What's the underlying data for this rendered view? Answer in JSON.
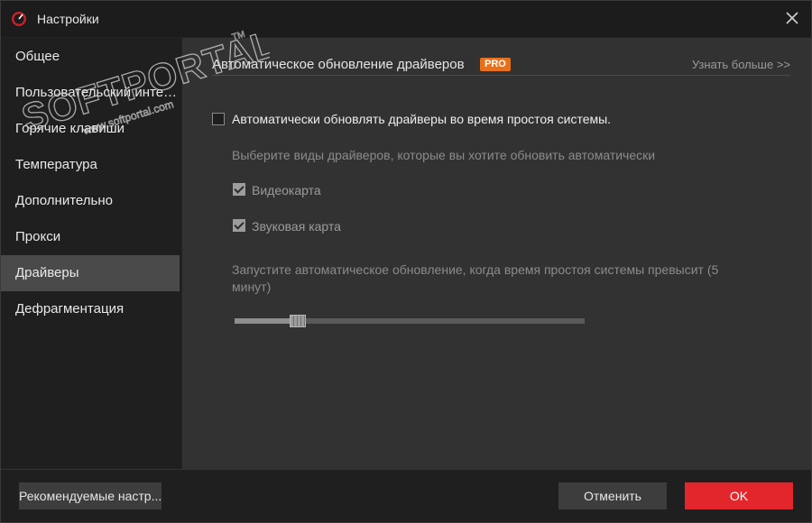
{
  "window": {
    "title": "Настройки",
    "icons": {
      "app": "app-speedometer-icon",
      "close": "close-icon"
    }
  },
  "sidebar": {
    "active_index": 6,
    "items": [
      {
        "label": "Общее"
      },
      {
        "label": "Пользовательский интерфейс"
      },
      {
        "label": "Горячие клавиши"
      },
      {
        "label": "Температура"
      },
      {
        "label": "Дополнительно"
      },
      {
        "label": "Прокси"
      },
      {
        "label": "Драйверы"
      },
      {
        "label": "Дефрагментация"
      }
    ]
  },
  "main": {
    "section_title": "Автоматическое обновление драйверов",
    "pro_badge": "PRO",
    "learn_more": "Узнать больше >>",
    "auto_update": {
      "label": "Автоматически обновлять драйверы во время простоя системы.",
      "checked": false
    },
    "driver_types_hint": "Выберите виды драйверов, которые вы хотите обновить автоматически",
    "driver_types": [
      {
        "label": "Видеокарта",
        "checked": true
      },
      {
        "label": "Звуковая карта",
        "checked": true
      }
    ],
    "idle_threshold_text": "Запустите автоматическое обновление, когда время простоя системы превысит (5 минут)",
    "idle_slider": {
      "value_fraction": 0.18
    }
  },
  "footer": {
    "recommended_label": "Рекомендуемые настр...",
    "cancel_label": "Отменить",
    "ok_label": "OK"
  },
  "watermark": {
    "brand": "SOFTPORTAL",
    "url": "www.softportal.com",
    "tm": "TM"
  },
  "colors": {
    "accent": "#e3262b",
    "pro": "#e8701a",
    "active_nav": "#4a4a4a"
  }
}
